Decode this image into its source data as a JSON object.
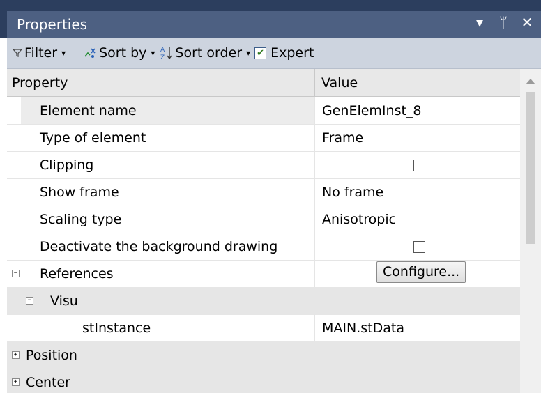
{
  "window": {
    "title": "Properties",
    "dropdown_glyph": "▾",
    "pin_glyph": "ᛘ",
    "close_glyph": "✕"
  },
  "toolbar": {
    "filter_label": "Filter",
    "sort_by_label": "Sort by",
    "sort_order_label": "Sort order",
    "expert_label": "Expert",
    "expert_checked": true
  },
  "grid": {
    "columns": {
      "property": "Property",
      "value": "Value"
    },
    "rows": [
      {
        "name": "Element name",
        "value": "GenElemInst_8"
      },
      {
        "name": "Type of element",
        "value": "Frame"
      },
      {
        "name": "Clipping",
        "value": ""
      },
      {
        "name": "Show frame",
        "value": "No frame"
      },
      {
        "name": "Scaling type",
        "value": "Anisotropic"
      },
      {
        "name": "Deactivate the background drawing",
        "value": ""
      },
      {
        "name": "References",
        "value": "",
        "button": "Configure..."
      },
      {
        "name": "Visu",
        "value": ""
      },
      {
        "name": "stInstance",
        "value": "MAIN.stData"
      },
      {
        "name": "Position",
        "value": ""
      },
      {
        "name": "Center",
        "value": ""
      }
    ]
  },
  "colors": {
    "titlebar": "#4d6082",
    "toolbar": "#cdd4df",
    "group_row": "#e6e6e6"
  }
}
